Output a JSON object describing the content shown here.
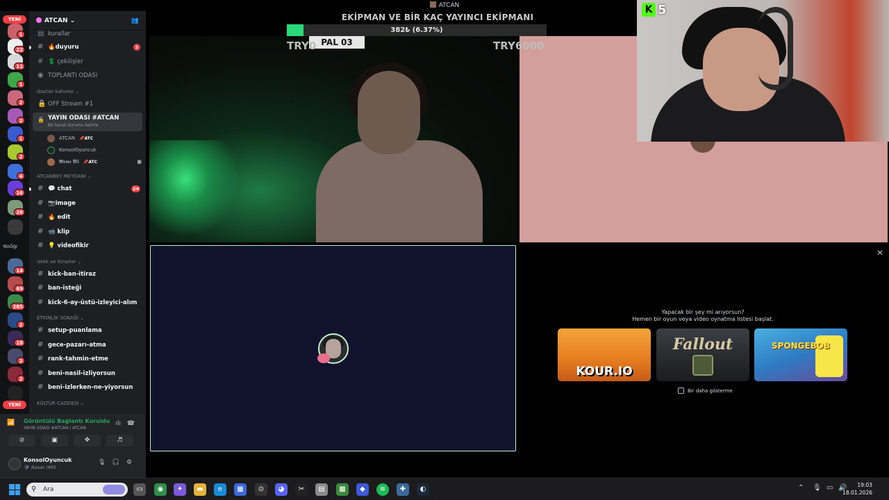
{
  "window": {
    "title": "ATCAN"
  },
  "rail": {
    "new_badge_top": "YENİ",
    "new_badge_bottom": "YENİ",
    "badges": [
      "1",
      "22",
      "11",
      "1",
      "2",
      "2",
      "1",
      "2",
      "4",
      "16",
      "26",
      "14",
      "69",
      "385",
      "2",
      "18",
      "2",
      "2"
    ],
    "label": "YönÖğr"
  },
  "server": {
    "name": "ATCAN",
    "channels_top": [
      {
        "name": "kurallar"
      },
      {
        "name": "🔥duyuru",
        "count": "2"
      },
      {
        "name": "💲 çekilişler"
      },
      {
        "name": "TOPLANTI ODASI"
      }
    ],
    "cat_dostlar": "dostlar kahvesi",
    "off_stream": "OFF Stream #1",
    "voice": {
      "title": "YAYIN ODASI #ATCAN",
      "status": "Bir kanal durumu belirle"
    },
    "voice_users": [
      {
        "name": "ATCAN",
        "tag": "📌ATC"
      },
      {
        "name": "KonsolOyuncuk",
        "tag": ""
      },
      {
        "name": "𝕸𝖊𝖒𝖊 𝕬𝖑𝖎",
        "tag": "📌ATC"
      }
    ],
    "cat_meydan": "ATCANBEY MEYDANI",
    "channels_meydan": [
      {
        "name": "💬 chat",
        "count": "24"
      },
      {
        "name": "📷image"
      },
      {
        "name": "🔥 edit"
      },
      {
        "name": "📹 klip"
      },
      {
        "name": "💡 videofikir"
      }
    ],
    "cat_istek": "istek ve itirazlar",
    "channels_istek": [
      {
        "name": "kick-ban-itiraz"
      },
      {
        "name": "ban-isteği"
      },
      {
        "name": "kick-6-ay-üstü-izleyici-alım"
      }
    ],
    "cat_etkinlik": "ETKİNLİK SOKAĞI",
    "channels_etkinlik": [
      {
        "name": "setup-puanlama"
      },
      {
        "name": "gece-pazarı-atma"
      },
      {
        "name": "rank-tahmin-etme"
      },
      {
        "name": "beni-nasil-izliyorsun"
      },
      {
        "name": "beni-izlerken-ne-yiyorsun"
      }
    ],
    "cat_kultur": "KÜLTÜR CADDESİ"
  },
  "connection": {
    "status": "Görüntülü Bağlantı Kuruldu",
    "location": "YAYIN ODASI #ATCAN / ATCAN"
  },
  "user": {
    "name": "KonsolOyuncuk",
    "status": "🛡 /kasar /405"
  },
  "overlay": {
    "goal_title": "EKİPMAN VE BİR KAÇ YAYINCI EKİPMANI",
    "goal_text": "382₺ (6.37%)",
    "goal_progress": 0.0637,
    "goal_left": "TRY0",
    "goal_right": "TRY6000",
    "plate": "PAL 03",
    "kick_value": "5",
    "kick_letter": "K"
  },
  "activity": {
    "question": "Yapacak bir şey mi arıyorsun?",
    "subtitle": "Hemen bir oyun veya video oynatma listesi başlat.",
    "games": [
      "KOUR.IO",
      "Fallout",
      "SPONGEBOB"
    ],
    "dont_show": "Bir daha gösterme"
  },
  "taskbar": {
    "search_placeholder": "Ara",
    "time": "19:03",
    "date": "18.01.2026"
  },
  "colors": {
    "accent_green": "#29d97a",
    "badge_red": "#f23f43",
    "kick_green": "#53fc18"
  }
}
